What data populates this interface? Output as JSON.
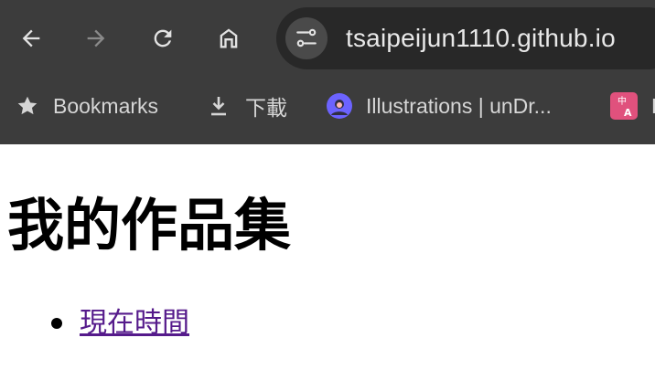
{
  "toolbar": {
    "back_icon": "arrow-left",
    "forward_icon": "arrow-right",
    "reload_icon": "reload",
    "home_icon": "home",
    "site_info_icon": "tune",
    "url": "tsaipeijun1110.github.io"
  },
  "bookmarks_bar": {
    "items": [
      {
        "label": "Bookmarks",
        "icon": "star"
      },
      {
        "label": "下載",
        "icon": "download"
      },
      {
        "label": "Illustrations | unDr...",
        "icon": "undraw-favicon"
      },
      {
        "label": "P",
        "icon": "translate-favicon"
      }
    ]
  },
  "page": {
    "heading": "我的作品集",
    "links": [
      {
        "label": "現在時間"
      }
    ]
  },
  "colors": {
    "chrome_bg": "#3c3c3c",
    "omnibox_bg": "#282828",
    "link_visited": "#551a8b"
  }
}
